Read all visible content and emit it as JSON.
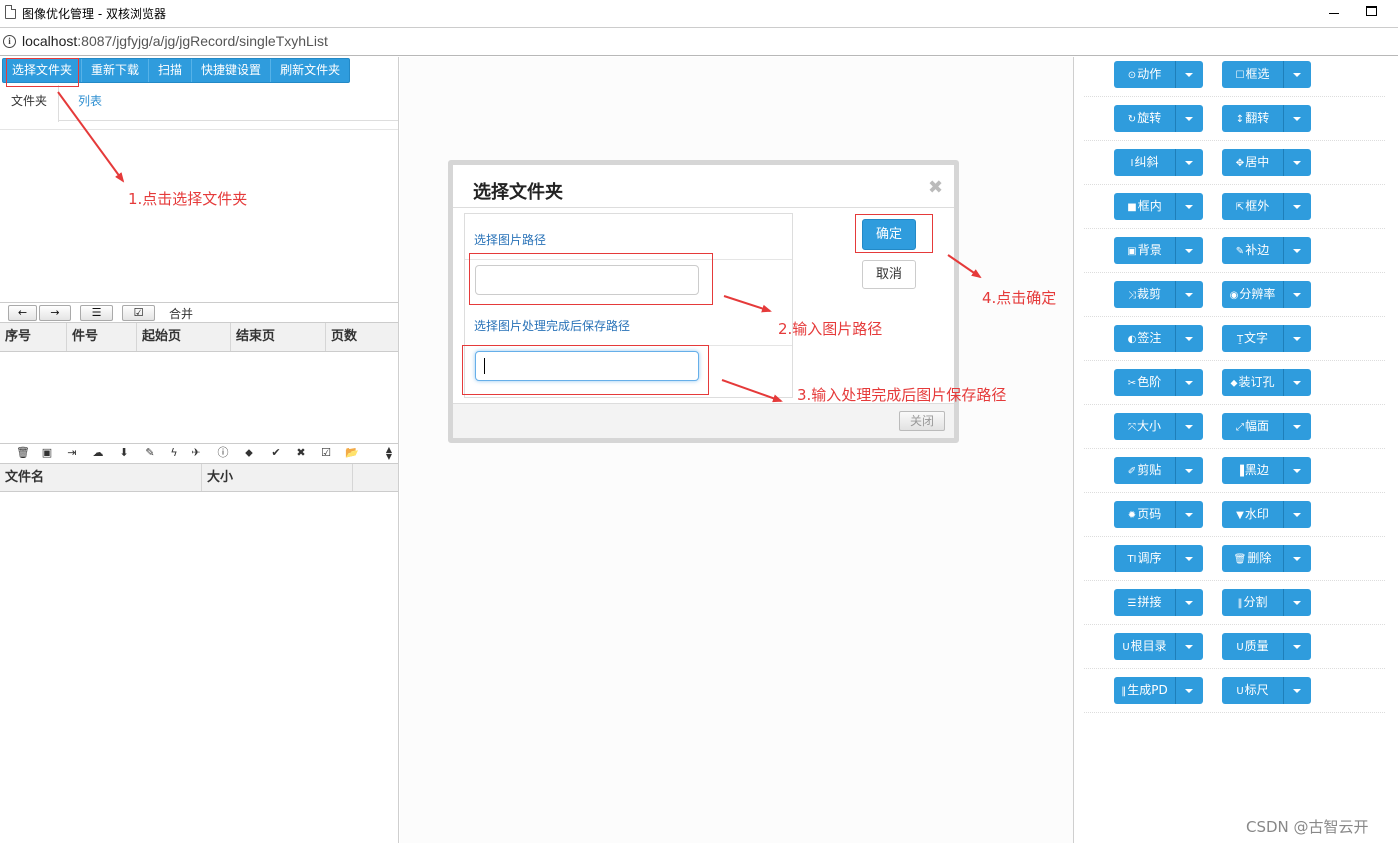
{
  "window": {
    "title": "图像优化管理 - 双核浏览器",
    "url_host": "localhost",
    "url_path": ":8087/jgfyjg/a/jg/jgRecord/singleTxyhList"
  },
  "toolbar": {
    "buttons": [
      "选择文件夹",
      "重新下载",
      "扫描",
      "快捷键设置",
      "刷新文件夹"
    ]
  },
  "tabs": {
    "folder": "文件夹",
    "list": "列表"
  },
  "pager": {
    "merge_label": "合并"
  },
  "grid": {
    "columns": [
      "序号",
      "件号",
      "起始页",
      "结束页",
      "页数"
    ]
  },
  "file_grid": {
    "columns": [
      "文件名",
      "大小"
    ]
  },
  "dialog": {
    "title": "选择文件夹",
    "image_path_label": "选择图片路径",
    "image_path_value": "",
    "save_path_label": "选择图片处理完成后保存路径",
    "save_path_value": "",
    "ok_label": "确定",
    "cancel_label": "取消",
    "close_label": "关闭"
  },
  "annotations": {
    "step1": "1.点击选择文件夹",
    "step2": "2.输入图片路径",
    "step3": "3.输入处理完成后图片保存路径",
    "step4": "4.点击确定"
  },
  "tools": [
    {
      "glyph": "⊙",
      "label": "动作"
    },
    {
      "glyph": "☐",
      "label": "框选"
    },
    {
      "glyph": "↻",
      "label": "旋转"
    },
    {
      "glyph": "↕",
      "label": "翻转"
    },
    {
      "glyph": "I",
      "label": "纠斜"
    },
    {
      "glyph": "✥",
      "label": "居中"
    },
    {
      "glyph": "■",
      "label": "框内"
    },
    {
      "glyph": "⇱",
      "label": "框外"
    },
    {
      "glyph": "▣",
      "label": "背景"
    },
    {
      "glyph": "✎",
      "label": "补边"
    },
    {
      "glyph": "⤨",
      "label": "裁剪"
    },
    {
      "glyph": "◉",
      "label": "分辨率"
    },
    {
      "glyph": "◐",
      "label": "签注"
    },
    {
      "glyph": "Ṯ",
      "label": "文字"
    },
    {
      "glyph": "✂",
      "label": "色阶"
    },
    {
      "glyph": "⬥",
      "label": "装订孔"
    },
    {
      "glyph": "⤧",
      "label": "大小"
    },
    {
      "glyph": "⤢",
      "label": "幅面"
    },
    {
      "glyph": "✐",
      "label": "剪贴"
    },
    {
      "glyph": "▐",
      "label": "黑边"
    },
    {
      "glyph": "✹",
      "label": "页码"
    },
    {
      "glyph": "▼",
      "label": "水印"
    },
    {
      "glyph": "TI",
      "label": "调序"
    },
    {
      "glyph": "🗑",
      "label": "删除"
    },
    {
      "glyph": "☰",
      "label": "拼接"
    },
    {
      "glyph": "‖",
      "label": "分割"
    },
    {
      "glyph": "U",
      "label": "根目录"
    },
    {
      "glyph": "U",
      "label": "质量"
    },
    {
      "glyph": "‖",
      "label": "生成PD"
    },
    {
      "glyph": "U",
      "label": "标尺"
    }
  ],
  "watermark": "CSDN @古智云开",
  "colors": {
    "primary": "#2f9cdd",
    "annotation": "#e53a3a",
    "link": "#2a73b8"
  }
}
